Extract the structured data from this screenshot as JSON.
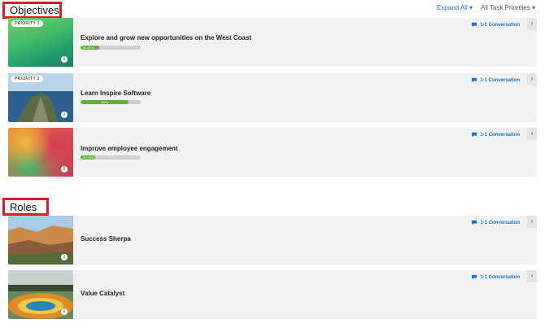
{
  "sections": {
    "objectives_title": "Objectives",
    "roles_title": "Roles"
  },
  "controls": {
    "expand_all": "Expand All ▾",
    "all_task_priorities": "All Task Priorities ▾"
  },
  "objectives": [
    {
      "priority": "PRIORITY 1",
      "title": "Explore and grow new opportunities on the West Coast",
      "progress_label": "31.67%",
      "progress": 0.3167,
      "conversation": "1-1 Conversation"
    },
    {
      "priority": "PRIORITY 2",
      "title": "Learn Inspire Software",
      "progress_label": "80%",
      "progress": 0.8,
      "conversation": "1-1 Conversation"
    },
    {
      "title": "Improve employee engagement",
      "progress_label": "23.75%",
      "progress": 0.2375,
      "conversation": "1-1 Conversation"
    }
  ],
  "roles": [
    {
      "title": "Success Sherpa",
      "conversation": "1-1 Conversation"
    },
    {
      "title": "Value Catalyst",
      "conversation": "1-1 Conversation"
    }
  ],
  "colors": {
    "accent": "#1a73c9",
    "progress": "#5fb33b",
    "highlight_border": "#e01b22"
  }
}
